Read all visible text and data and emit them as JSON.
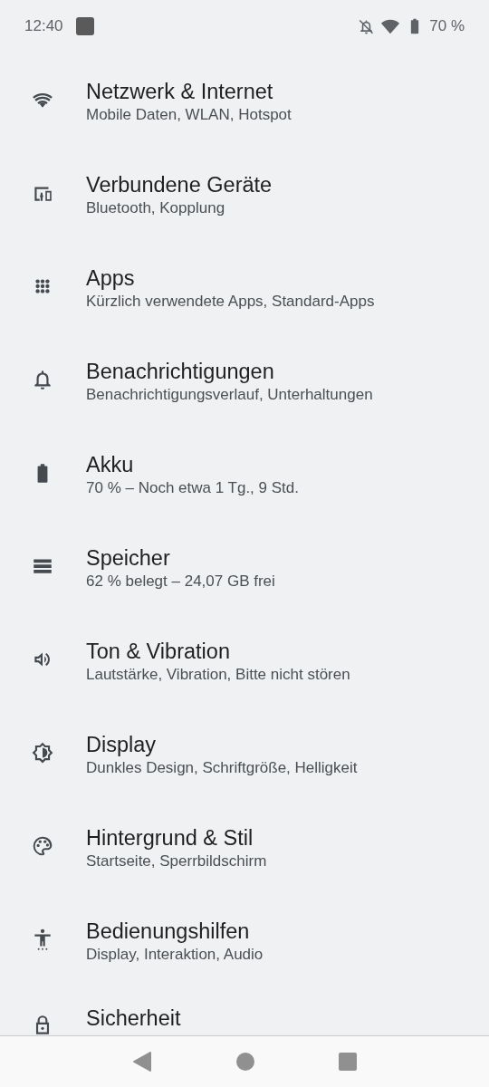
{
  "status_bar": {
    "time": "12:40",
    "battery": "70 %"
  },
  "settings": [
    {
      "title": "Netzwerk & Internet",
      "summary": "Mobile Daten, WLAN, Hotspot"
    },
    {
      "title": "Verbundene Geräte",
      "summary": "Bluetooth, Kopplung"
    },
    {
      "title": "Apps",
      "summary": "Kürzlich verwendete Apps, Standard-Apps"
    },
    {
      "title": "Benachrichtigungen",
      "summary": "Benachrichtigungsverlauf, Unterhaltungen"
    },
    {
      "title": "Akku",
      "summary": "70 % – Noch etwa 1 Tg., 9 Std."
    },
    {
      "title": "Speicher",
      "summary": "62 % belegt – 24,07 GB frei"
    },
    {
      "title": "Ton & Vibration",
      "summary": "Lautstärke, Vibration, Bitte nicht stören"
    },
    {
      "title": "Display",
      "summary": "Dunkles Design, Schriftgröße, Helligkeit"
    },
    {
      "title": "Hintergrund & Stil",
      "summary": "Startseite, Sperrbildschirm"
    },
    {
      "title": "Bedienungshilfen",
      "summary": "Display, Interaktion, Audio"
    },
    {
      "title": "Sicherheit"
    }
  ]
}
